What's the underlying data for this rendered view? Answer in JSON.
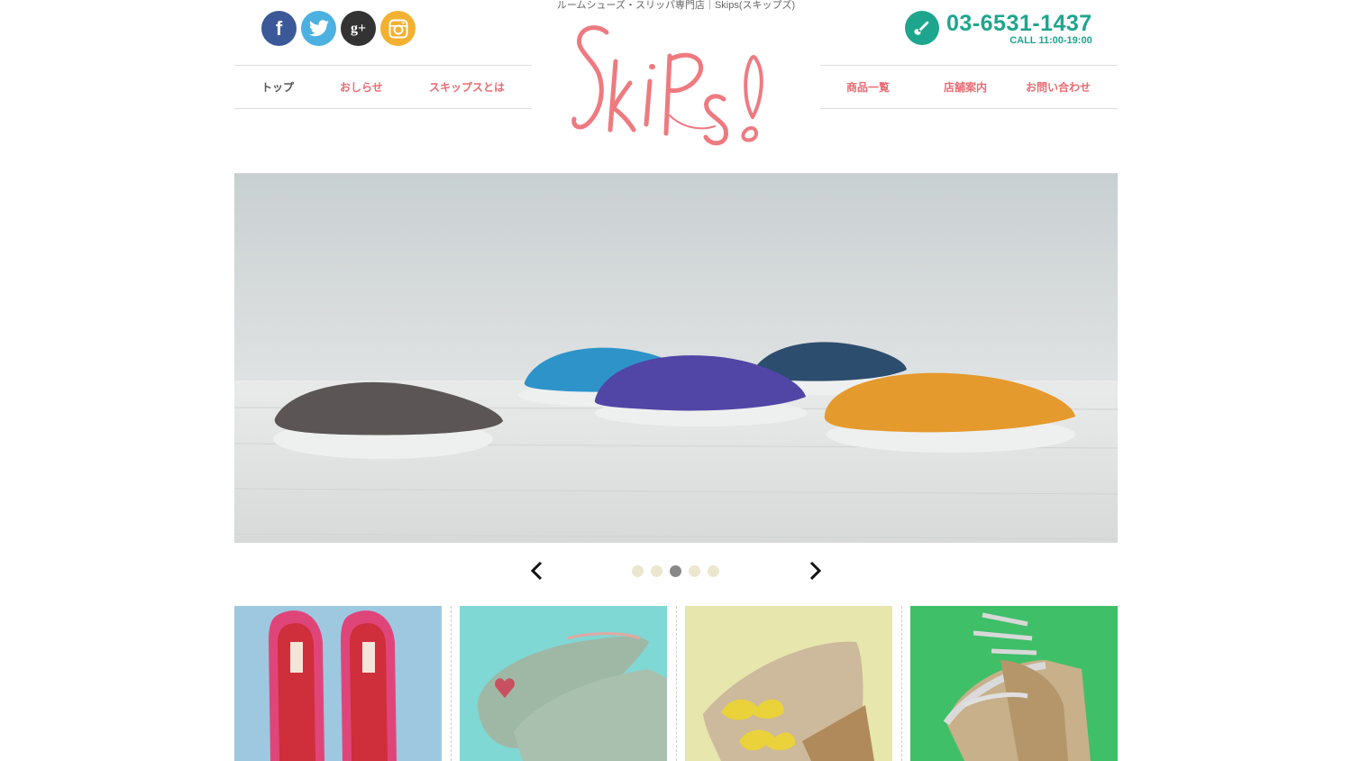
{
  "header": {
    "tagline": "ルームシューズ・スリッパ専門店｜Skips(スキップズ)",
    "logo_text": "Skips!"
  },
  "social": [
    {
      "name": "facebook",
      "icon": "facebook-icon",
      "glyph": "f",
      "color": "#3b5998"
    },
    {
      "name": "twitter",
      "icon": "twitter-icon",
      "color": "#4cb0e0"
    },
    {
      "name": "google-plus",
      "icon": "google-plus-icon",
      "glyph": "g+",
      "color": "#333333"
    },
    {
      "name": "instagram",
      "icon": "instagram-icon",
      "color": "#f3b131"
    }
  ],
  "contact": {
    "phone": "03-6531-1437",
    "hours": "CALL 11:00-19:00",
    "icon": "phone-icon",
    "color": "#1ea58e"
  },
  "nav_left": [
    {
      "label": "トップ",
      "active": true
    },
    {
      "label": "おしらせ",
      "active": false
    },
    {
      "label": "スキップスとは",
      "active": false
    }
  ],
  "nav_right": [
    {
      "label": "商品一覧"
    },
    {
      "label": "店舗案内"
    },
    {
      "label": "お問い合わせ"
    }
  ],
  "slider": {
    "dots": 5,
    "active_index": 2
  },
  "colors": {
    "accent": "#e86c73",
    "teal": "#1ea58e"
  }
}
